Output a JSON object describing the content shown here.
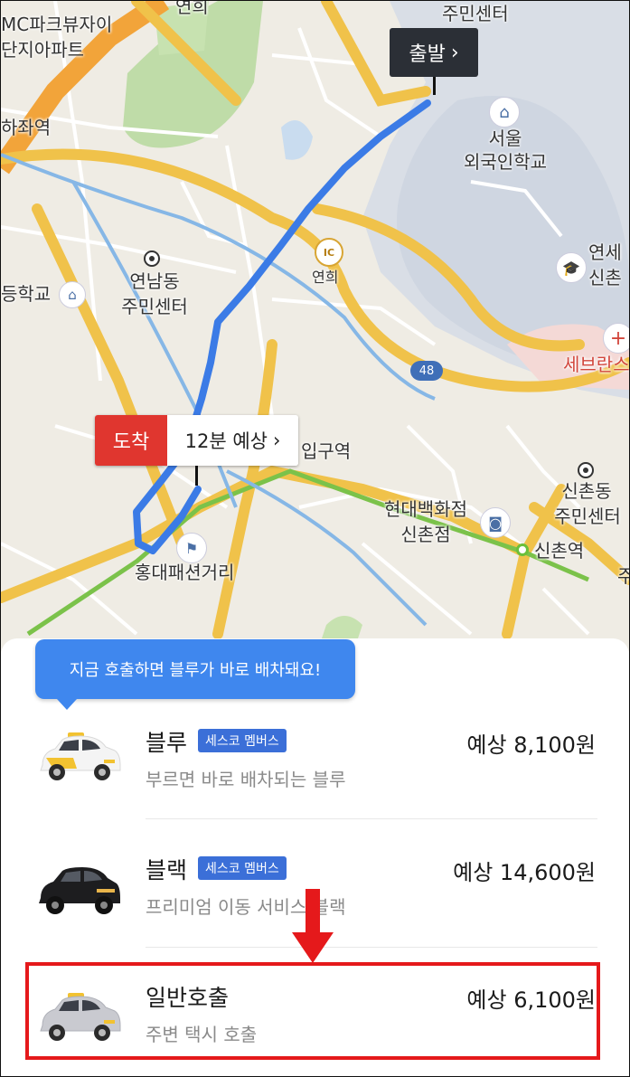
{
  "map": {
    "labels": {
      "yeonhui_top": "연희",
      "apartment_line1": "MC파크뷰자이",
      "apartment_line2": "단지아파트",
      "jumin_center_top": "주민센터",
      "station_left": "하좌역",
      "seoul_foreign_school_line1": "서울",
      "seoul_foreign_school_line2": "외국인학교",
      "ic_yeonhui": "연희",
      "yeonnam_center_line1": "연남동",
      "yeonnam_center_line2": "주민센터",
      "school_left": "등학교",
      "yonsei_line1": "연세",
      "yonsei_line2": "신촌",
      "severance": "세브란스",
      "hongik_station": "입구역",
      "hyundai_line1": "현대백화점",
      "hyundai_line2": "신촌점",
      "sinchon_center_line1": "신촌동",
      "sinchon_center_line2": "주민센터",
      "sinchon_station": "신촌역",
      "hongdae_street": "홍대패션거리",
      "ju_right": "주"
    },
    "highway_number": "48",
    "ic_label": "IC",
    "start_marker": "출발",
    "arrival_tag": "도착",
    "arrival_eta": "12분 예상",
    "chevron": "›"
  },
  "tooltip": "지금 호출하면 블루가 바로 배차돼요!",
  "options": [
    {
      "name": "블루",
      "badge": "세스코 멤버스",
      "desc": "부르면 바로 배차되는 블루",
      "price": "예상 8,100원"
    },
    {
      "name": "블랙",
      "badge": "세스코 멤버스",
      "desc": "프리미엄 이동 서비스 블랙",
      "price": "예상 14,600원"
    },
    {
      "name": "일반호출",
      "desc": "주변 택시 호출",
      "price": "예상 6,100원"
    }
  ],
  "colors": {
    "route": "#3b7be6",
    "arrival_red": "#e0362f",
    "badge_blue": "#3b6fd8",
    "highlight_red": "#e5191b",
    "road_yellow": "#f0c24a"
  },
  "icons": [
    "school-icon",
    "flag-icon",
    "shopping-bag-icon",
    "graduation-cap-icon",
    "hospital-icon",
    "blue-taxi-icon",
    "black-car-icon",
    "regular-taxi-icon",
    "down-arrow-icon"
  ]
}
